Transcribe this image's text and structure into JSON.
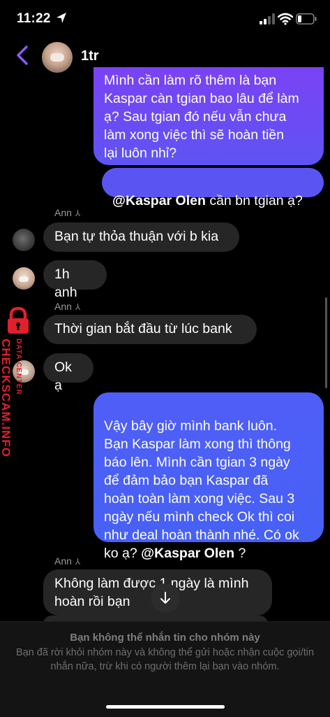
{
  "status_bar": {
    "time": "11:22"
  },
  "header": {
    "title": "1tr"
  },
  "messages": {
    "m1": "Mình cần làm rõ thêm là bạn\nKaspar càn tgian bao lâu để làm\nạ? Sau tgian đó nếu vẫn chưa\nlàm xong việc thì sẽ hoàn tiền\nlại luôn nhỉ?",
    "m2_mention": "@Kaspar Olen",
    "m2_rest": " cần bn tgian ạ?",
    "sender1": "Ann",
    "m3": "Bạn tự thỏa thuận với b kia",
    "m4": "1h anh",
    "sender2": "Ann",
    "m5": "Thời gian bắt đầu từ lúc bank",
    "m6": "Ok ạ",
    "m7_text": "Vậy bây giờ mình bank luôn.\nBạn Kaspar làm xong thì thông\nbáo lên. Mình cần tgian 3 ngày\nđể đảm bảo bạn Kaspar đã\nhoàn toàn làm xong việc. Sau 3\nngày nếu mình check Ok thì coi\nnhư deal hoàn thành nhé. Có ok\nko ạ? ",
    "m7_mention": "@Kaspar Olen",
    "m7_end": " ?",
    "sender3": "Ann",
    "m8": "Không làm được 1 ngày là mình\nhoàn rồi bạn"
  },
  "watermark": {
    "main": "CHECKSCAM.INFO",
    "sub": "DATA CENTER"
  },
  "footer": {
    "title": "Bạn không thể nhắn tin cho nhóm này",
    "body": "Bạn đã rời khỏi nhóm này và không thể gửi hoặc nhận cuộc gọi/tin nhắn nữa, trừ khi có người thêm lại bạn vào nhóm."
  },
  "colors": {
    "accent": "#7a42f4",
    "incoming": "#262626",
    "watermark": "#e0202a"
  }
}
